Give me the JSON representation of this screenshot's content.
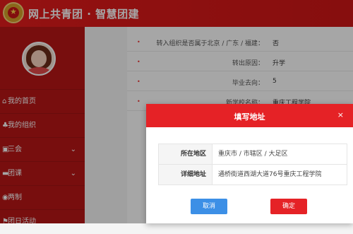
{
  "app": {
    "title": "网上共青团 · 智慧团建"
  },
  "sidebar": {
    "items": [
      {
        "label": "我的首页",
        "icon": "home-icon",
        "glyph": "⌂",
        "has_chevron": false
      },
      {
        "label": "我的组织",
        "icon": "group-icon",
        "glyph": "♣",
        "has_chevron": false
      },
      {
        "label": "三会",
        "icon": "calendar-icon",
        "glyph": "▣",
        "has_chevron": true
      },
      {
        "label": "团课",
        "icon": "folder-icon",
        "glyph": "▬",
        "has_chevron": true
      },
      {
        "label": "两制",
        "icon": "globe-icon",
        "glyph": "◉",
        "has_chevron": false
      },
      {
        "label": "团日活动",
        "icon": "flag-icon",
        "glyph": "⚑",
        "has_chevron": false
      }
    ]
  },
  "form": {
    "rows": [
      {
        "label": "转入组织是否属于北京 / 广东 / 福建：",
        "value": "否"
      },
      {
        "label": "转出原因：",
        "value": "升学"
      },
      {
        "label": "毕业去向：",
        "value": "5"
      },
      {
        "label": "新学校名称：",
        "value": "重庆工程学院"
      }
    ]
  },
  "modal": {
    "title": "填写地址",
    "close_glyph": "×",
    "rows": [
      {
        "key": "所在地区",
        "value": "重庆市 / 市辖区 / 大足区"
      },
      {
        "key": "详细地址",
        "value": "通桥街道西湖大道76号重庆工程学院"
      }
    ],
    "cancel_label": "取消",
    "confirm_label": "确定"
  }
}
